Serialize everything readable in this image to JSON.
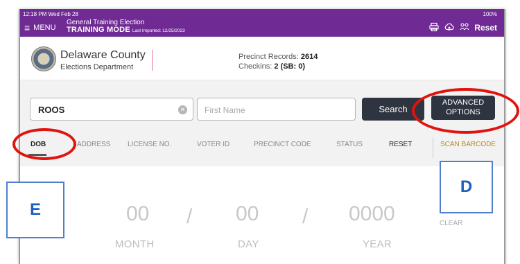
{
  "status_bar": {
    "time": "12:18 PM  Wed Feb 28",
    "battery": "100%"
  },
  "topbar": {
    "menu_label": "MENU",
    "election_title": "General Training Election",
    "mode": "TRAINING MODE",
    "last_imported": "Last Imported: 12/25/2023",
    "reset_label": "Reset",
    "icons": [
      "printer-icon",
      "cloud-sync-icon",
      "people-icon"
    ]
  },
  "header": {
    "county": "Delaware County",
    "department": "Elections Department",
    "precinct_records_label": "Precinct Records:",
    "precinct_records_value": "2614",
    "checkins_label": "Checkins:",
    "checkins_value": "2 (SB: 0)"
  },
  "search": {
    "last_name_value": "ROOS",
    "first_name_placeholder": "First Name",
    "search_label": "Search",
    "advanced_line1": "ADVANCED",
    "advanced_line2": "OPTIONS"
  },
  "tabs": {
    "dob": "DOB",
    "address": "ADDRESS",
    "license": "LICENSE NO.",
    "voter_id": "VOTER ID",
    "precinct_code": "PRECINCT CODE",
    "status": "STATUS",
    "reset": "RESET",
    "scan": "SCAN BARCODE"
  },
  "dob_entry": {
    "month_value": "00",
    "day_value": "00",
    "year_value": "0000",
    "separator": "/",
    "month_label": "MONTH",
    "day_label": "DAY",
    "year_label": "YEAR",
    "clear_label": "CLEAR"
  },
  "annotations": {
    "callout_d": "D",
    "callout_e": "E",
    "highlight_color": "#e0130f",
    "callout_color": "#4f7fcf"
  },
  "colors": {
    "accent_purple": "#6f2b93",
    "button_dark": "#2f3540",
    "scan_gold": "#b88a1a"
  }
}
